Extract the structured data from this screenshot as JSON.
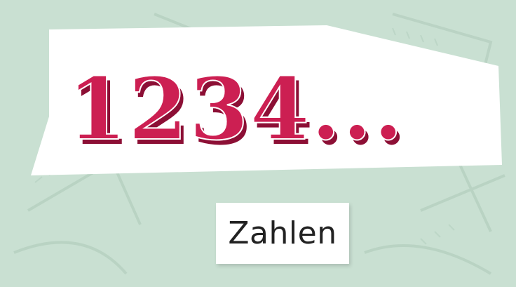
{
  "colors": {
    "background": "#c9e0d2",
    "background_pattern": "#b9d3c4",
    "banner": "#ffffff",
    "numerals": "#cc1f52",
    "numerals_shadow": "#8c0f35",
    "label_text": "#222222"
  },
  "headline": {
    "text": "1234..."
  },
  "label": {
    "text": "Zahlen"
  }
}
